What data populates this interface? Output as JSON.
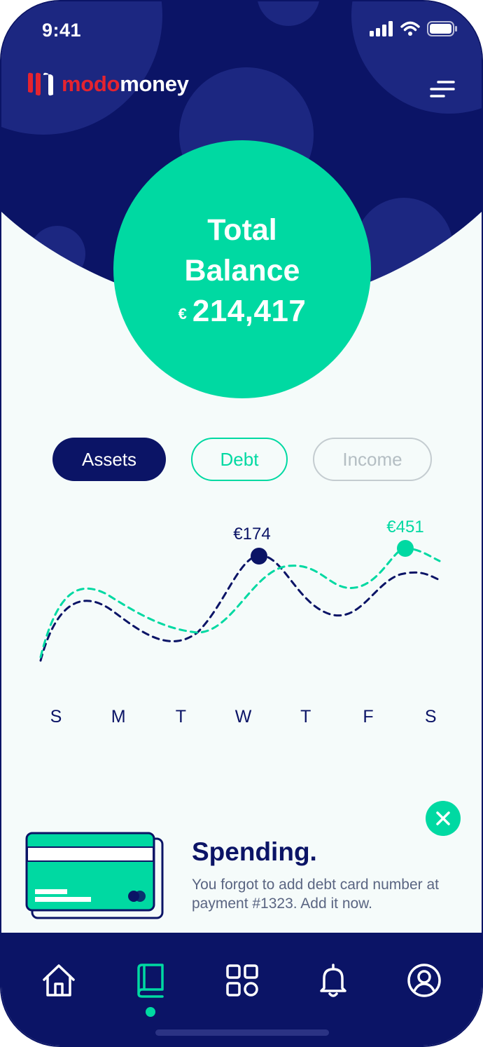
{
  "status_bar": {
    "time": "9:41"
  },
  "brand": {
    "modo": "modo",
    "money": "money"
  },
  "balance": {
    "title": "Total Balance",
    "currency": "€",
    "amount": "214,417"
  },
  "tabs": [
    {
      "label": "Assets",
      "active": true
    },
    {
      "label": "Debt",
      "active": false
    },
    {
      "label": "Income",
      "active": false
    }
  ],
  "chart_data": {
    "type": "line",
    "x": [
      "S",
      "M",
      "T",
      "W",
      "T",
      "F",
      "S"
    ],
    "series": [
      {
        "values": [
          null,
          null,
          null,
          174,
          null,
          null,
          null
        ]
      },
      {
        "values": [
          null,
          null,
          null,
          null,
          null,
          null,
          451
        ]
      }
    ],
    "annotations": [
      "€174",
      "€451"
    ],
    "grid": false
  },
  "spending": {
    "title": "Spending.",
    "message": "You forgot to add debt card number at payment #1323. Add it now."
  },
  "nav": {
    "items": [
      "home-icon",
      "book-icon",
      "grid-icon",
      "bell-icon",
      "profile-icon"
    ],
    "active_index": 1
  },
  "colors": {
    "navy": "#0b1466",
    "mint": "#00d9a2",
    "red": "#e5232f"
  }
}
